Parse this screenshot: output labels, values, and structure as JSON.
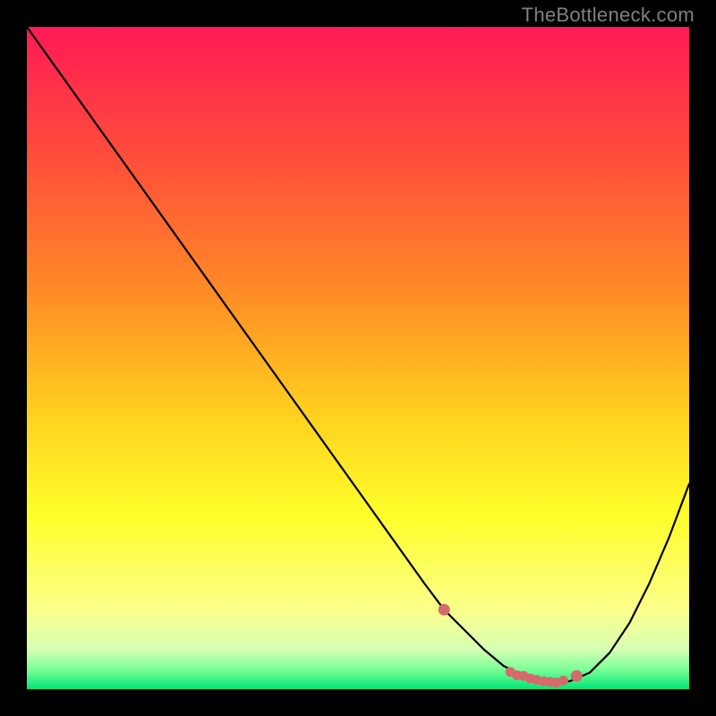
{
  "watermark": "TheBottleneck.com",
  "chart_data": {
    "type": "line",
    "title": "",
    "xlabel": "",
    "ylabel": "",
    "xlim": [
      0,
      100
    ],
    "ylim": [
      0,
      100
    ],
    "grid": false,
    "x": [
      0,
      5,
      10,
      15,
      20,
      25,
      30,
      35,
      40,
      45,
      50,
      55,
      60,
      63,
      66,
      69,
      72,
      75,
      78,
      80,
      82,
      85,
      88,
      91,
      94,
      97,
      100
    ],
    "values": [
      100,
      93,
      86,
      79,
      72,
      65,
      58,
      51,
      44,
      37,
      30,
      23,
      16,
      12,
      9,
      6,
      3.5,
      2,
      1.2,
      1,
      1.2,
      2.5,
      5.5,
      10,
      16,
      23,
      31
    ],
    "series_color": "#000000",
    "marker_color": "#d46a6a",
    "markers_x": [
      63,
      73,
      74,
      75,
      76,
      77,
      78,
      79,
      80,
      81,
      83
    ],
    "markers_y": [
      12,
      2.6,
      2.1,
      2.0,
      1.6,
      1.4,
      1.2,
      1.1,
      1.0,
      1.3,
      2.0
    ],
    "background_gradient": {
      "stops": [
        {
          "offset": 0.0,
          "color": "#ff1a55"
        },
        {
          "offset": 0.2,
          "color": "#ff4e3a"
        },
        {
          "offset": 0.4,
          "color": "#ff8b26"
        },
        {
          "offset": 0.58,
          "color": "#ffcf1e"
        },
        {
          "offset": 0.74,
          "color": "#ffff2b"
        },
        {
          "offset": 0.88,
          "color": "#fbff8a"
        },
        {
          "offset": 0.94,
          "color": "#d7ffb4"
        },
        {
          "offset": 0.97,
          "color": "#7cff97"
        },
        {
          "offset": 1.0,
          "color": "#00e676"
        }
      ]
    }
  }
}
